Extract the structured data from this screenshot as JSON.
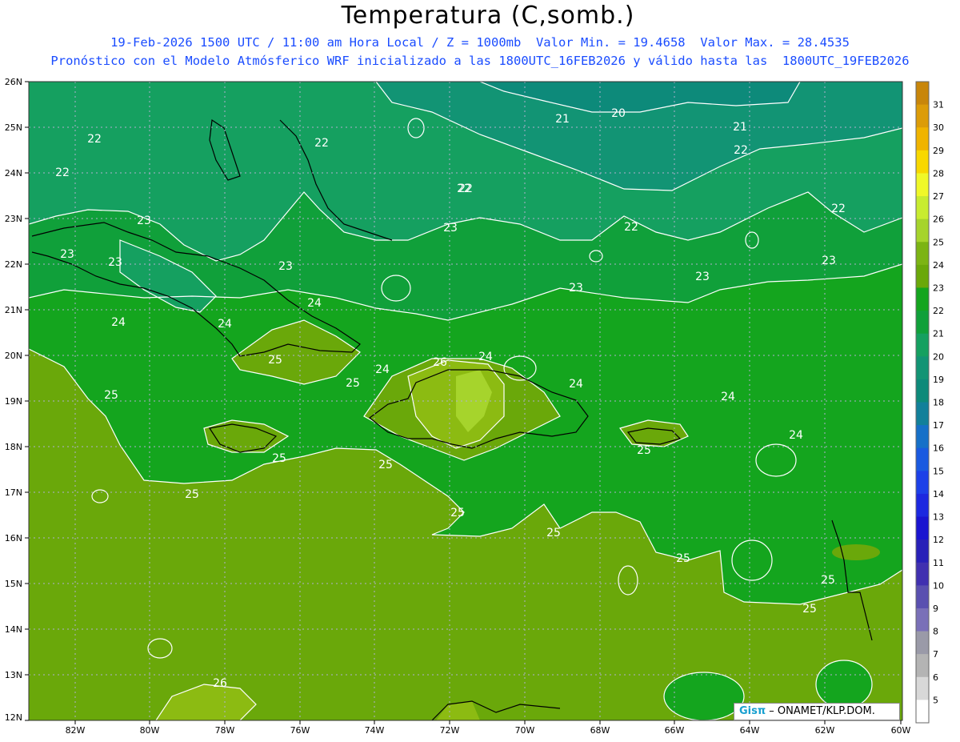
{
  "header": {
    "title": "Temperatura (C,somb.)",
    "line2": "19-Feb-2026 1500 UTC / 11:00 am Hora Local / Z = 1000mb  Valor Min. = 19.4658  Valor Max. = 28.4535",
    "line3": "Pronóstico con el Modelo Atmósferico WRF inicializado a las 1800UTC_16FEB2026 y válido hasta las  1800UTC_19FEB2026"
  },
  "map": {
    "lat_labels": [
      "26N",
      "25N",
      "24N",
      "23N",
      "22N",
      "21N",
      "20N",
      "19N",
      "18N",
      "17N",
      "16N",
      "15N",
      "14N",
      "13N",
      "12N"
    ],
    "lon_labels": [
      "82W",
      "80W",
      "78W",
      "76W",
      "74W",
      "72W",
      "70W",
      "68W",
      "66W",
      "64W",
      "62W",
      "60W"
    ],
    "contour_labels": [
      "22",
      "22",
      "22",
      "22",
      "21",
      "20",
      "21",
      "22",
      "22",
      "22",
      "22",
      "23",
      "23",
      "23",
      "23",
      "23",
      "23",
      "23",
      "23",
      "24",
      "24",
      "24",
      "24",
      "24",
      "24",
      "24",
      "24",
      "25",
      "25",
      "25",
      "25",
      "25",
      "25",
      "25",
      "25",
      "25",
      "25",
      "25",
      "25",
      "26",
      "26"
    ],
    "colors": {
      "t20": "#0d8a7a",
      "t21": "#129474",
      "t22": "#15a060",
      "t23": "#10a03a",
      "t24": "#14a51e",
      "t25": "#6aa80a",
      "t26": "#8cbb12",
      "t27": "#a6d42c",
      "contour": "#ffffff",
      "coast": "#000000",
      "grid": "#b0b0d0"
    }
  },
  "colorbar": {
    "labels": [
      "31",
      "30",
      "29",
      "28",
      "27",
      "26",
      "25",
      "24",
      "23",
      "22",
      "21",
      "20",
      "19",
      "18",
      "17",
      "16",
      "15",
      "14",
      "13",
      "12",
      "11",
      "10",
      "9",
      "8",
      "7",
      "6",
      "5"
    ],
    "colors": [
      "#c8860a",
      "#dc9c08",
      "#f0b400",
      "#f8d800",
      "#f0f828",
      "#c8ec30",
      "#a6d42c",
      "#7cb414",
      "#6aa80a",
      "#14a51e",
      "#10a03a",
      "#15a060",
      "#129474",
      "#0d8a7a",
      "#12809a",
      "#1670c8",
      "#1a5ae0",
      "#1c40e8",
      "#1c28e0",
      "#1a14d0",
      "#2820b8",
      "#4030b0",
      "#5a50b0",
      "#7a70b8",
      "#9a9aa8",
      "#b4b4b4",
      "#d8d8d8",
      "#ffffff"
    ]
  },
  "credit": {
    "logo": "Gisπ",
    "text": " – ONAMET/KLP.DOM."
  }
}
